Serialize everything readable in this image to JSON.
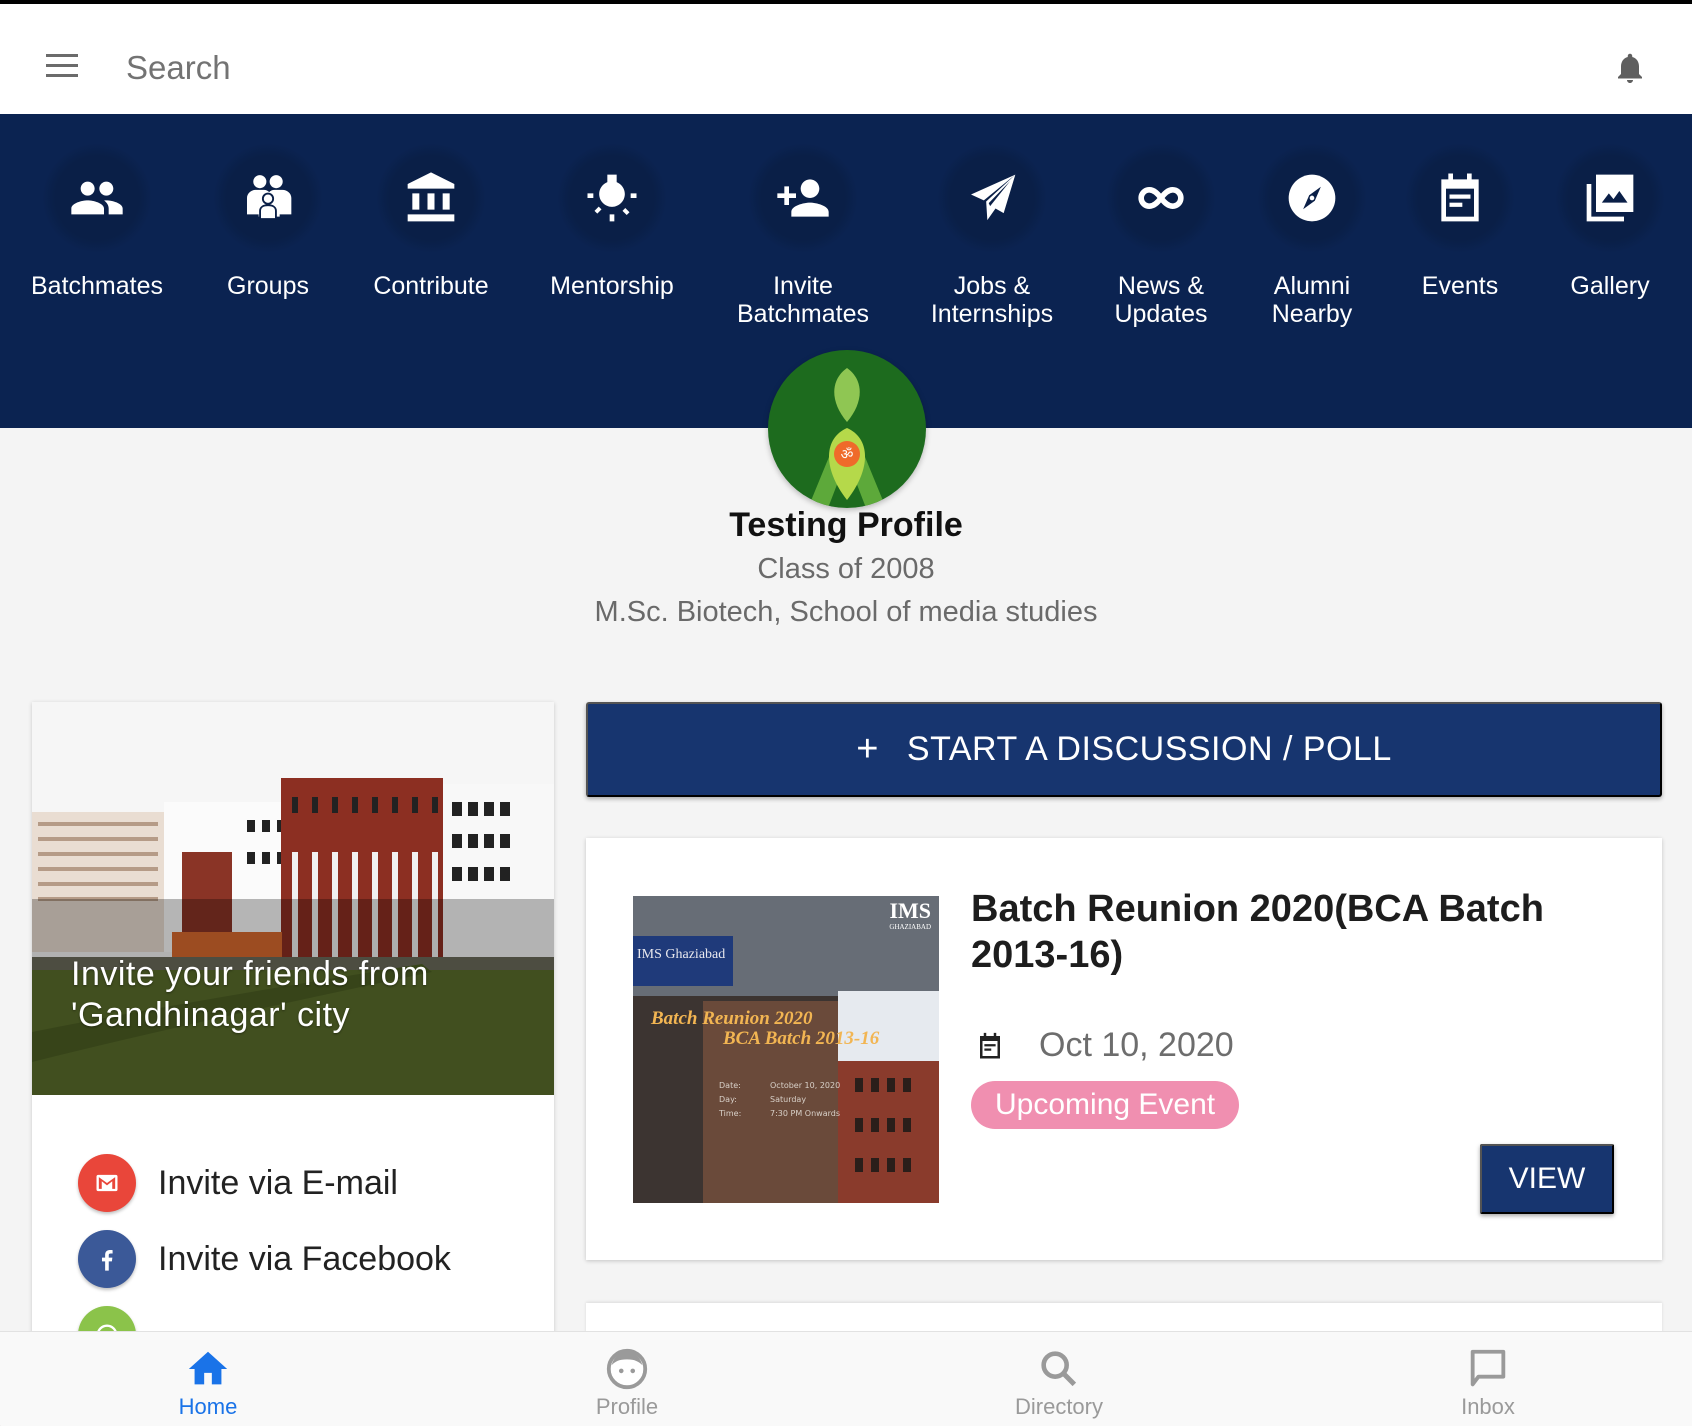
{
  "appbar": {
    "search_placeholder": "Search",
    "menu_icon": "hamburger-menu-icon",
    "notification_icon": "bell-icon"
  },
  "nav": {
    "items": [
      {
        "label": "Batchmates",
        "icon": "people-icon"
      },
      {
        "label": "Groups",
        "icon": "family-group-icon"
      },
      {
        "label": "Contribute",
        "icon": "bank-icon"
      },
      {
        "label": "Mentorship",
        "icon": "lightbulb-icon"
      },
      {
        "label": "Invite\nBatchmates",
        "icon": "person-add-icon"
      },
      {
        "label": "Jobs &\nInternships",
        "icon": "paper-plane-icon"
      },
      {
        "label": "News &\nUpdates",
        "icon": "infinity-icon"
      },
      {
        "label": "Alumni\nNearby",
        "icon": "compass-icon"
      },
      {
        "label": "Events",
        "icon": "calendar-icon"
      },
      {
        "label": "Gallery",
        "icon": "photo-library-icon"
      }
    ]
  },
  "profile": {
    "name": "Testing Profile",
    "class_of": "Class of 2008",
    "department": "M.Sc. Biotech, School of media studies"
  },
  "invite_card": {
    "banner_text": "Invite your friends from 'Gandhinagar' city",
    "options": [
      {
        "label": "Invite via E-mail",
        "icon": "gmail-icon",
        "color": "#e9463a"
      },
      {
        "label": "Invite via Facebook",
        "icon": "facebook-icon",
        "color": "#3b5998"
      },
      {
        "label": "",
        "icon": "whatsapp-icon",
        "color": "#8bc34a"
      }
    ]
  },
  "discussion": {
    "button_label": "START A DISCUSSION / POLL",
    "plus": "+"
  },
  "event": {
    "title": "Batch Reunion 2020(BCA Batch 2013-16)",
    "date": "Oct 10, 2020",
    "badge": "Upcoming Event",
    "view_label": "VIEW",
    "poster": {
      "logo": "IMS",
      "logo_sub": "GHAZIABAD",
      "sign": "IMS Ghaziabad",
      "heading1": "Batch Reunion 2020",
      "heading2": "BCA Batch 2013-16",
      "date_label": "Date:",
      "date_value": "October 10, 2020",
      "day_label": "Day:",
      "day_value": "Saturday",
      "time_label": "Time:",
      "time_value": "7:30 PM Onwards"
    }
  },
  "bottom_nav": {
    "items": [
      {
        "label": "Home",
        "icon": "home-icon",
        "active": true
      },
      {
        "label": "Profile",
        "icon": "face-icon",
        "active": false
      },
      {
        "label": "Directory",
        "icon": "search-icon",
        "active": false
      },
      {
        "label": "Inbox",
        "icon": "chat-bubble-icon",
        "active": false
      }
    ]
  },
  "colors": {
    "primary": "#0b2351",
    "button": "#17356f",
    "badge": "#f08fb0",
    "active_tab": "#1a73e8"
  }
}
